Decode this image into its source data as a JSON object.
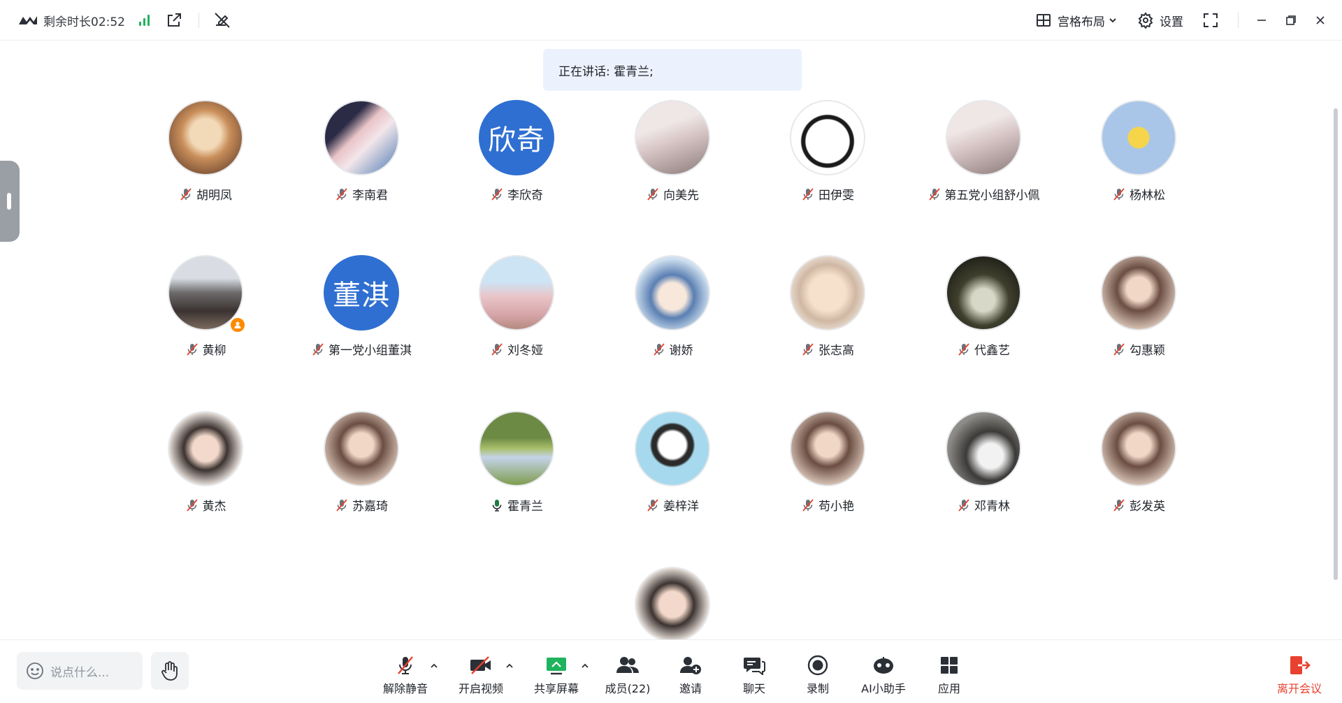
{
  "topbar": {
    "remaining_time": "剩余时长02:52",
    "layout_label": "宫格布局",
    "settings_label": "设置"
  },
  "speaking_banner": "正在讲话: 霍青兰;",
  "participants": [
    {
      "name": "胡明凤",
      "avatar": "cat-photo",
      "mic": "muted"
    },
    {
      "name": "李南君",
      "avatar": "anime-photo",
      "mic": "muted"
    },
    {
      "name": "李欣奇",
      "avatar": "initials",
      "initials": "欣奇",
      "mic": "muted"
    },
    {
      "name": "向美先",
      "avatar": "photo",
      "mic": "muted"
    },
    {
      "name": "田伊雯",
      "avatar": "panda-sticker",
      "mic": "muted"
    },
    {
      "name": "第五党小组舒小佩",
      "avatar": "photo",
      "mic": "muted"
    },
    {
      "name": "杨林松",
      "avatar": "cartoon-bird",
      "mic": "muted"
    },
    {
      "name": "黄柳",
      "avatar": "landscape-photo",
      "mic": "muted",
      "host": true
    },
    {
      "name": "第一党小组董淇",
      "avatar": "initials",
      "initials": "董淇",
      "mic": "muted"
    },
    {
      "name": "刘冬娅",
      "avatar": "street-photo",
      "mic": "muted"
    },
    {
      "name": "谢娇",
      "avatar": "cartoon-girl",
      "mic": "muted"
    },
    {
      "name": "张志高",
      "avatar": "cartoon-kid",
      "mic": "muted"
    },
    {
      "name": "代鑫艺",
      "avatar": "cat-photo-dark",
      "mic": "muted"
    },
    {
      "name": "勾惠颖",
      "avatar": "portrait-photo",
      "mic": "muted"
    },
    {
      "name": "黄杰",
      "avatar": "child-photo",
      "mic": "muted"
    },
    {
      "name": "苏嘉琦",
      "avatar": "portrait-photo",
      "mic": "muted"
    },
    {
      "name": "霍青兰",
      "avatar": "field-photo",
      "mic": "speaking"
    },
    {
      "name": "姜梓洋",
      "avatar": "cartoon-boy",
      "mic": "muted"
    },
    {
      "name": "苟小艳",
      "avatar": "portrait-photo",
      "mic": "muted"
    },
    {
      "name": "邓青林",
      "avatar": "dog-photo",
      "mic": "muted"
    },
    {
      "name": "彭发英",
      "avatar": "portrait-photo",
      "mic": "muted"
    },
    {
      "name": "",
      "avatar": "child-photo",
      "mic": "none"
    }
  ],
  "bottombar": {
    "chat_placeholder": "说点什么...",
    "unmute": "解除静音",
    "start_video": "开启视频",
    "share_screen": "共享屏幕",
    "members": "成员(22)",
    "invite": "邀请",
    "chat": "聊天",
    "record": "录制",
    "ai_assistant": "AI小助手",
    "apps": "应用",
    "leave": "离开会议"
  },
  "colors": {
    "accent_blue": "#2f6fd1",
    "signal_green": "#1fb35e",
    "leave_red": "#e8412f",
    "share_green": "#1fb35e",
    "muted_red": "#e8412f"
  }
}
